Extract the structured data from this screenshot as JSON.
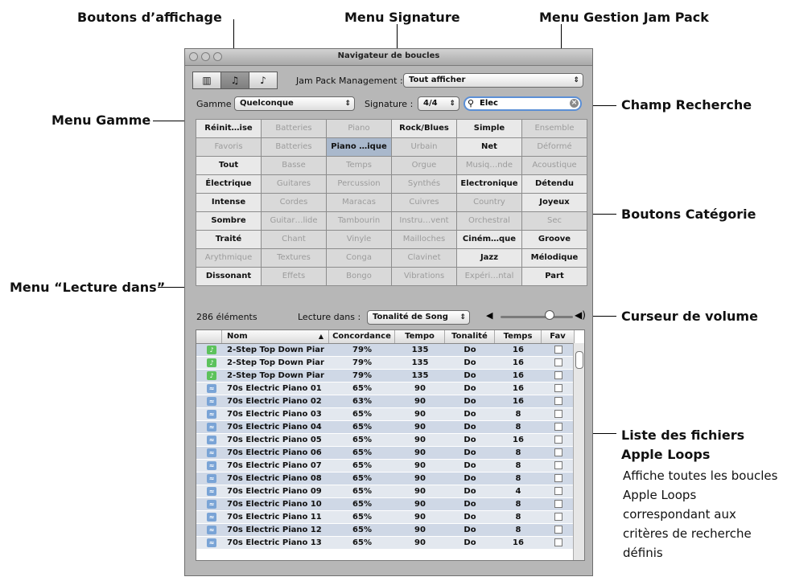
{
  "callouts": {
    "view_buttons": "Boutons d’affichage",
    "signature_menu": "Menu Signature",
    "jampack_menu": "Menu Gestion Jam Pack",
    "search_field": "Champ Recherche",
    "scale_menu": "Menu Gamme",
    "category_buttons": "Boutons Catégorie",
    "play_in_menu": "Menu “Lecture dans”",
    "volume_slider": "Curseur de volume",
    "loops_list": "Liste des fichiers Apple Loops",
    "loops_desc": "Affiche toutes les boucles Apple Loops correspondant aux critères de recherche définis"
  },
  "window": {
    "title": "Navigateur de boucles",
    "jampack_label": "Jam Pack Management :",
    "jampack_value": "Tout afficher",
    "scale_label": "Gamme :",
    "scale_value": "Quelconque",
    "signature_label": "Signature :",
    "signature_value": "4/4",
    "search_value": "Elec",
    "count": "286 éléments",
    "play_in_label": "Lecture dans :",
    "play_in_value": "Tonalité de Song",
    "volume_level": 0.68
  },
  "categories": [
    {
      "label": "Réinit…ise",
      "state": "on"
    },
    {
      "label": "Batteries",
      "state": "off"
    },
    {
      "label": "Piano",
      "state": "off"
    },
    {
      "label": "Rock/Blues",
      "state": "on"
    },
    {
      "label": "Simple",
      "state": "on"
    },
    {
      "label": "Ensemble",
      "state": "off"
    },
    {
      "label": "Favoris",
      "state": "off"
    },
    {
      "label": "Batteries",
      "state": "off"
    },
    {
      "label": "Piano …ique",
      "state": "sel"
    },
    {
      "label": "Urbain",
      "state": "off"
    },
    {
      "label": "Net",
      "state": "on"
    },
    {
      "label": "Déformé",
      "state": "off"
    },
    {
      "label": "Tout",
      "state": "on"
    },
    {
      "label": "Basse",
      "state": "off"
    },
    {
      "label": "Temps",
      "state": "off"
    },
    {
      "label": "Orgue",
      "state": "off"
    },
    {
      "label": "Musiq…nde",
      "state": "off"
    },
    {
      "label": "Acoustique",
      "state": "off"
    },
    {
      "label": "Électrique",
      "state": "on"
    },
    {
      "label": "Guitares",
      "state": "off"
    },
    {
      "label": "Percussion",
      "state": "off"
    },
    {
      "label": "Synthés",
      "state": "off"
    },
    {
      "label": "Electronique",
      "state": "on"
    },
    {
      "label": "Détendu",
      "state": "on"
    },
    {
      "label": "Intense",
      "state": "on"
    },
    {
      "label": "Cordes",
      "state": "off"
    },
    {
      "label": "Maracas",
      "state": "off"
    },
    {
      "label": "Cuivres",
      "state": "off"
    },
    {
      "label": "Country",
      "state": "off"
    },
    {
      "label": "Joyeux",
      "state": "on"
    },
    {
      "label": "Sombre",
      "state": "on"
    },
    {
      "label": "Guitar…lide",
      "state": "off"
    },
    {
      "label": "Tambourin",
      "state": "off"
    },
    {
      "label": "Instru…vent",
      "state": "off"
    },
    {
      "label": "Orchestral",
      "state": "off"
    },
    {
      "label": "Sec",
      "state": "off"
    },
    {
      "label": "Traité",
      "state": "on"
    },
    {
      "label": "Chant",
      "state": "off"
    },
    {
      "label": "Vinyle",
      "state": "off"
    },
    {
      "label": "Mailloches",
      "state": "off"
    },
    {
      "label": "Ciném…que",
      "state": "on"
    },
    {
      "label": "Groove",
      "state": "on"
    },
    {
      "label": "Arythmique",
      "state": "off"
    },
    {
      "label": "Textures",
      "state": "off"
    },
    {
      "label": "Conga",
      "state": "off"
    },
    {
      "label": "Clavinet",
      "state": "off"
    },
    {
      "label": "Jazz",
      "state": "on"
    },
    {
      "label": "Mélodique",
      "state": "on"
    },
    {
      "label": "Dissonant",
      "state": "on"
    },
    {
      "label": "Effets",
      "state": "off"
    },
    {
      "label": "Bongo",
      "state": "off"
    },
    {
      "label": "Vibrations",
      "state": "off"
    },
    {
      "label": "Expéri…ntal",
      "state": "off"
    },
    {
      "label": "Part",
      "state": "on"
    }
  ],
  "table": {
    "headers": [
      "Nom",
      "Concordance",
      "Tempo",
      "Tonalité",
      "Temps",
      "Fav"
    ],
    "rows": [
      {
        "type": "green",
        "name": "2-Step Top Down Piar",
        "match": "79%",
        "tempo": "135",
        "key": "Do",
        "beats": "16"
      },
      {
        "type": "green",
        "name": "2-Step Top Down Piar",
        "match": "79%",
        "tempo": "135",
        "key": "Do",
        "beats": "16"
      },
      {
        "type": "green",
        "name": "2-Step Top Down Piar",
        "match": "79%",
        "tempo": "135",
        "key": "Do",
        "beats": "16"
      },
      {
        "type": "blue",
        "name": "70s Electric Piano 01",
        "match": "65%",
        "tempo": "90",
        "key": "Do",
        "beats": "16"
      },
      {
        "type": "blue",
        "name": "70s Electric Piano 02",
        "match": "63%",
        "tempo": "90",
        "key": "Do",
        "beats": "16"
      },
      {
        "type": "blue",
        "name": "70s Electric Piano 03",
        "match": "65%",
        "tempo": "90",
        "key": "Do",
        "beats": "8"
      },
      {
        "type": "blue",
        "name": "70s Electric Piano 04",
        "match": "65%",
        "tempo": "90",
        "key": "Do",
        "beats": "8"
      },
      {
        "type": "blue",
        "name": "70s Electric Piano 05",
        "match": "65%",
        "tempo": "90",
        "key": "Do",
        "beats": "16"
      },
      {
        "type": "blue",
        "name": "70s Electric Piano 06",
        "match": "65%",
        "tempo": "90",
        "key": "Do",
        "beats": "8"
      },
      {
        "type": "blue",
        "name": "70s Electric Piano 07",
        "match": "65%",
        "tempo": "90",
        "key": "Do",
        "beats": "8"
      },
      {
        "type": "blue",
        "name": "70s Electric Piano 08",
        "match": "65%",
        "tempo": "90",
        "key": "Do",
        "beats": "8"
      },
      {
        "type": "blue",
        "name": "70s Electric Piano 09",
        "match": "65%",
        "tempo": "90",
        "key": "Do",
        "beats": "4"
      },
      {
        "type": "blue",
        "name": "70s Electric Piano 10",
        "match": "65%",
        "tempo": "90",
        "key": "Do",
        "beats": "8"
      },
      {
        "type": "blue",
        "name": "70s Electric Piano 11",
        "match": "65%",
        "tempo": "90",
        "key": "Do",
        "beats": "8"
      },
      {
        "type": "blue",
        "name": "70s Electric Piano 12",
        "match": "65%",
        "tempo": "90",
        "key": "Do",
        "beats": "8"
      },
      {
        "type": "blue",
        "name": "70s Electric Piano 13",
        "match": "65%",
        "tempo": "90",
        "key": "Do",
        "beats": "16"
      }
    ]
  }
}
